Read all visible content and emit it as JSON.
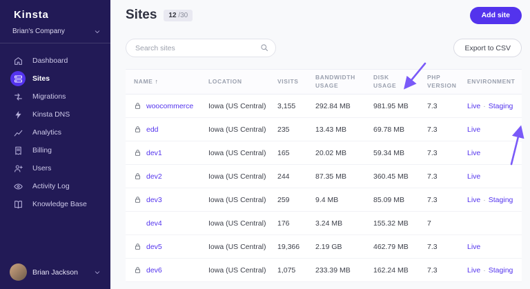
{
  "colors": {
    "accent": "#5333ed",
    "sidebar_bg": "#221a56",
    "link": "#5333ed",
    "arrow": "#7a5af8"
  },
  "sidebar": {
    "logo": "Kinsta",
    "company": "Brian's Company",
    "items": [
      {
        "label": "Dashboard",
        "icon": "dashboard-icon",
        "active": false
      },
      {
        "label": "Sites",
        "icon": "sites-icon",
        "active": true
      },
      {
        "label": "Migrations",
        "icon": "migrations-icon",
        "active": false
      },
      {
        "label": "Kinsta DNS",
        "icon": "dns-icon",
        "active": false
      },
      {
        "label": "Analytics",
        "icon": "analytics-icon",
        "active": false
      },
      {
        "label": "Billing",
        "icon": "billing-icon",
        "active": false
      },
      {
        "label": "Users",
        "icon": "users-icon",
        "active": false
      },
      {
        "label": "Activity Log",
        "icon": "activity-log-icon",
        "active": false
      },
      {
        "label": "Knowledge Base",
        "icon": "knowledge-base-icon",
        "active": false
      }
    ],
    "user_name": "Brian Jackson"
  },
  "header": {
    "title": "Sites",
    "count": "12",
    "count_total": "/30",
    "add_site_label": "Add site"
  },
  "toolbar": {
    "search_placeholder": "Search sites",
    "export_label": "Export to CSV"
  },
  "table": {
    "sort_arrow": "↑",
    "env_separator": "·",
    "columns": [
      {
        "label": "NAME",
        "sorted": true
      },
      {
        "label": "LOCATION"
      },
      {
        "label": "VISITS"
      },
      {
        "label": "BANDWIDTH USAGE"
      },
      {
        "label": "DISK USAGE"
      },
      {
        "label": "PHP VERSION"
      },
      {
        "label": "ENVIRONMENT"
      }
    ],
    "rows": [
      {
        "lock": true,
        "name": "woocommerce",
        "location": "Iowa (US Central)",
        "visits": "3,155",
        "bandwidth": "292.84 MB",
        "disk": "981.95 MB",
        "php": "7.3",
        "env": [
          "Live",
          "Staging"
        ]
      },
      {
        "lock": true,
        "name": "edd",
        "location": "Iowa (US Central)",
        "visits": "235",
        "bandwidth": "13.43 MB",
        "disk": "69.78 MB",
        "php": "7.3",
        "env": [
          "Live"
        ]
      },
      {
        "lock": true,
        "name": "dev1",
        "location": "Iowa (US Central)",
        "visits": "165",
        "bandwidth": "20.02 MB",
        "disk": "59.34 MB",
        "php": "7.3",
        "env": [
          "Live"
        ]
      },
      {
        "lock": true,
        "name": "dev2",
        "location": "Iowa (US Central)",
        "visits": "244",
        "bandwidth": "87.35 MB",
        "disk": "360.45 MB",
        "php": "7.3",
        "env": [
          "Live"
        ]
      },
      {
        "lock": true,
        "name": "dev3",
        "location": "Iowa (US Central)",
        "visits": "259",
        "bandwidth": "9.4 MB",
        "disk": "85.09 MB",
        "php": "7.3",
        "env": [
          "Live",
          "Staging"
        ]
      },
      {
        "lock": false,
        "name": "dev4",
        "location": "Iowa (US Central)",
        "visits": "176",
        "bandwidth": "3.24 MB",
        "disk": "155.32 MB",
        "php": "7",
        "env": []
      },
      {
        "lock": true,
        "name": "dev5",
        "location": "Iowa (US Central)",
        "visits": "19,366",
        "bandwidth": "2.19 GB",
        "disk": "462.79 MB",
        "php": "7.3",
        "env": [
          "Live"
        ]
      },
      {
        "lock": true,
        "name": "dev6",
        "location": "Iowa (US Central)",
        "visits": "1,075",
        "bandwidth": "233.39 MB",
        "disk": "162.24 MB",
        "php": "7.3",
        "env": [
          "Live",
          "Staging"
        ]
      }
    ]
  }
}
